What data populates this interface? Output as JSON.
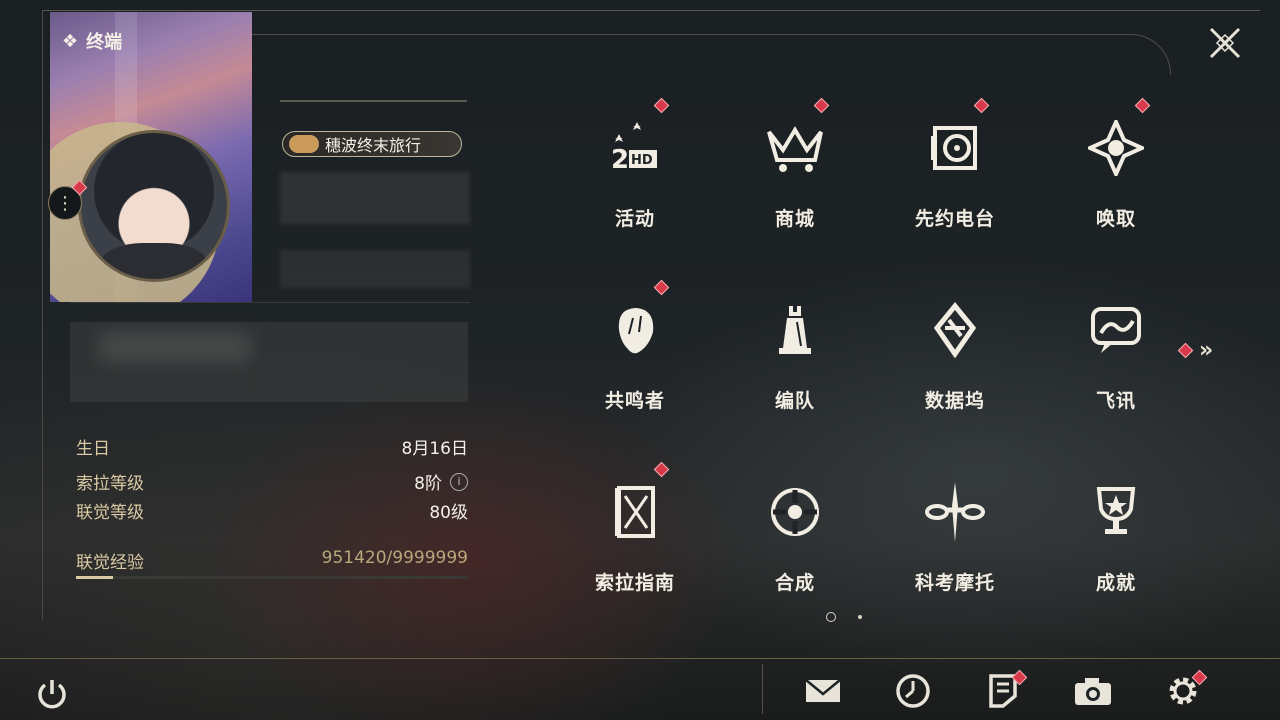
{
  "header": {
    "title": "终端"
  },
  "profile": {
    "title_badge": "穗波终末旅行",
    "stats": [
      {
        "label": "生日",
        "value": "8月16日"
      },
      {
        "label": "索拉等级",
        "value": "8阶"
      },
      {
        "label": "联觉等级",
        "value": "80级"
      }
    ],
    "exp": {
      "label": "联觉经验",
      "value": "951420/9999999",
      "progress": 0.095
    }
  },
  "menu": {
    "items": [
      {
        "label": "活动",
        "icon": "activity-icon",
        "alert": true
      },
      {
        "label": "商城",
        "icon": "shop-cart-icon",
        "alert": true
      },
      {
        "label": "先约电台",
        "icon": "radio-icon",
        "alert": true
      },
      {
        "label": "唤取",
        "icon": "summon-compass-icon",
        "alert": true
      },
      {
        "label": "共鸣者",
        "icon": "resonator-portrait-icon",
        "alert": true
      },
      {
        "label": "编队",
        "icon": "team-chess-icon",
        "alert": false
      },
      {
        "label": "数据坞",
        "icon": "data-dock-icon",
        "alert": false
      },
      {
        "label": "飞讯",
        "icon": "message-bubble-icon",
        "alert": false
      },
      {
        "label": "索拉指南",
        "icon": "guide-book-icon",
        "alert": true
      },
      {
        "label": "合成",
        "icon": "synthesis-icon",
        "alert": false
      },
      {
        "label": "科考摩托",
        "icon": "motorcycle-icon",
        "alert": false
      },
      {
        "label": "成就",
        "icon": "trophy-icon",
        "alert": false
      }
    ],
    "pagination": {
      "current": 1,
      "total": 2
    }
  },
  "bottom_bar": {
    "buttons": [
      {
        "icon": "mail-icon",
        "alert": false
      },
      {
        "icon": "clock-icon",
        "alert": false
      },
      {
        "icon": "notice-icon",
        "alert": true
      },
      {
        "icon": "camera-icon",
        "alert": false
      },
      {
        "icon": "settings-gear-icon",
        "alert": true
      }
    ]
  },
  "colors": {
    "accent_gold": "#d9c9a4",
    "alert_red": "#d93a4a",
    "background": "#1e2326"
  }
}
